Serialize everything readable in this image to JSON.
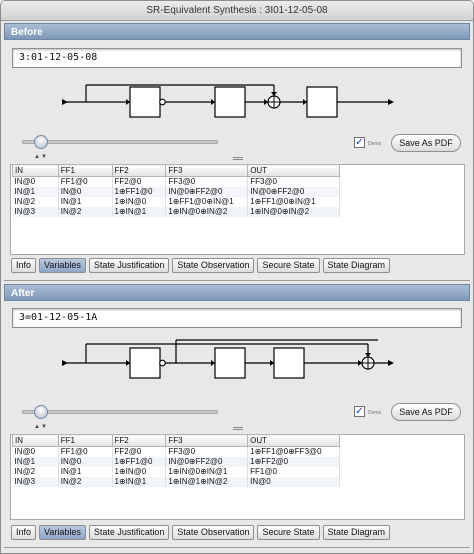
{
  "window": {
    "title": "SR-Equivalent Synthesis : 3I01-12-05-08"
  },
  "colors": {
    "header": "#8aa2c2",
    "selected_tab": "#9fb3d1",
    "check": "#1a3fa8"
  },
  "panes": [
    {
      "header": "Before",
      "sequence": "3:01-12-05-08",
      "checkbox_label": "Demo",
      "checkbox_checked": true,
      "pdf_button": "Save As PDF",
      "slider_value": 0.1,
      "table": {
        "columns": [
          "IN",
          "FF1",
          "FF2",
          "FF3",
          "OUT"
        ],
        "rows": [
          [
            "IN@0",
            "FF1@0",
            "FF2@0",
            "FF3@0",
            "FF3@0"
          ],
          [
            "IN@1",
            "IN@0",
            "1⊕FF1@0",
            "IN@0⊕FF2@0",
            "IN@0⊕FF2@0"
          ],
          [
            "IN@2",
            "IN@1",
            "1⊕IN@0",
            "1⊕FF1@0⊕IN@1",
            "1⊕FF1@0⊕IN@1"
          ],
          [
            "IN@3",
            "IN@2",
            "1⊕IN@1",
            "1⊕IN@0⊕IN@2",
            "1⊕IN@0⊕IN@2"
          ]
        ]
      },
      "tabs": [
        "Info",
        "Variables",
        "State Justification",
        "State Observation",
        "Secure State",
        "State Diagram"
      ],
      "selected_tab": 1
    },
    {
      "header": "After",
      "sequence": "3=01-12-05-1A",
      "checkbox_label": "Demo",
      "checkbox_checked": true,
      "pdf_button": "Save As PDF",
      "slider_value": 0.1,
      "table": {
        "columns": [
          "IN",
          "FF1",
          "FF2",
          "FF3",
          "OUT"
        ],
        "rows": [
          [
            "IN@0",
            "FF1@0",
            "FF2@0",
            "FF3@0",
            "1⊕FF1@0⊕FF3@0"
          ],
          [
            "IN@1",
            "IN@0",
            "1⊕FF1@0",
            "IN@0⊕FF2@0",
            "1⊕FF2@0"
          ],
          [
            "IN@2",
            "IN@1",
            "1⊕IN@0",
            "1⊕IN@0⊕IN@1",
            "FF1@0"
          ],
          [
            "IN@3",
            "IN@2",
            "1⊕IN@1",
            "1⊕IN@1⊕IN@2",
            "IN@0"
          ]
        ]
      },
      "tabs": [
        "Info",
        "Variables",
        "State Justification",
        "State Observation",
        "Secure State",
        "State Diagram"
      ],
      "selected_tab": 1
    }
  ]
}
